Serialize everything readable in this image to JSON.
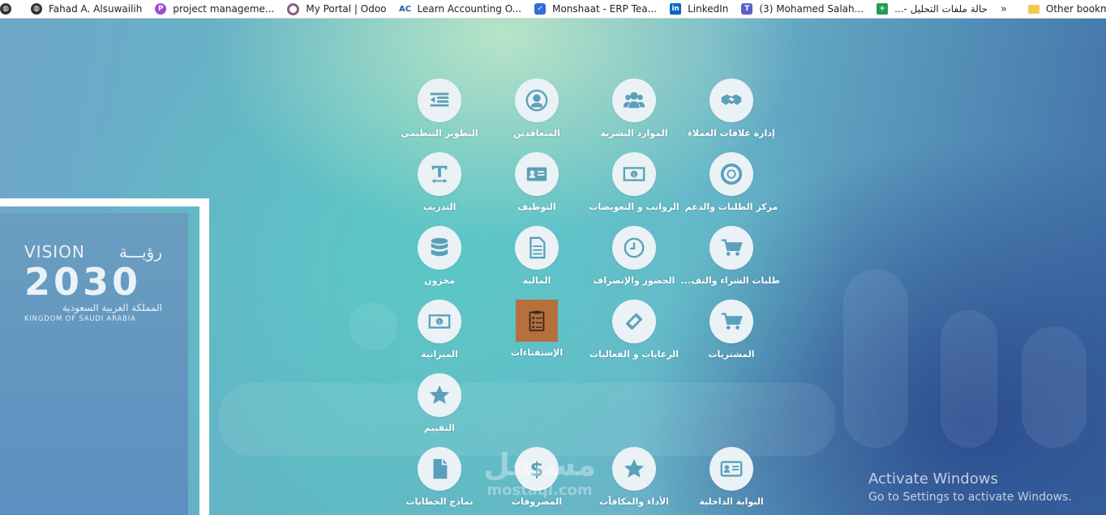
{
  "bookmarks": {
    "items": [
      {
        "label": "",
        "icon": "globe-icon"
      },
      {
        "label": "Fahad A. Alsuwailih",
        "icon": "globe-icon"
      },
      {
        "label": "project manageme...",
        "icon": "podcast-icon"
      },
      {
        "label": "My Portal | Odoo",
        "icon": "odoo-icon"
      },
      {
        "label": "Learn Accounting O...",
        "icon": "ac-icon"
      },
      {
        "label": "Monshaat - ERP Tea...",
        "icon": "teams-icon"
      },
      {
        "label": "LinkedIn",
        "icon": "linkedin-icon"
      },
      {
        "label": "(3) Mohamed Salah...",
        "icon": "teams-icon"
      },
      {
        "label": "حالة ملفات التحليل -...",
        "icon": "sheets-icon"
      }
    ],
    "overflow": "»",
    "other": "Other bookmarks"
  },
  "vision": {
    "vision_en": "VISION",
    "vision_ar": "رؤيـــة",
    "year": "2030",
    "kingdom_ar": "المملكة العربية السعودية",
    "kingdom_en": "KINGDOM OF SAUDI ARABIA"
  },
  "apps": [
    {
      "label": "إدارة علاقات العملاء",
      "icon": "handshake-icon"
    },
    {
      "label": "الموارد البشرية",
      "icon": "users-icon"
    },
    {
      "label": "المتعاقدين",
      "icon": "user-icon"
    },
    {
      "label": "التطوير التنظيمي",
      "icon": "outdent-icon"
    },
    {
      "label": "مركز الطلبات والدعم",
      "icon": "lifebuoy-icon"
    },
    {
      "label": "الرواتب و التعويضات",
      "icon": "money-icon"
    },
    {
      "label": "التوظيف",
      "icon": "id-card-icon"
    },
    {
      "label": "التدريب",
      "icon": "text-width-icon"
    },
    {
      "label": "طلبات الشراء والتف...",
      "icon": "cart-icon"
    },
    {
      "label": "الحضور والإنصراف",
      "icon": "clock-icon"
    },
    {
      "label": "المالية",
      "icon": "document-icon"
    },
    {
      "label": "مخزون",
      "icon": "database-icon"
    },
    {
      "label": "المشتريات",
      "icon": "cart-icon"
    },
    {
      "label": "الرعايات و الفعاليات",
      "icon": "ticket-icon"
    },
    {
      "label": "الإستفتاءات",
      "icon": "survey-icon"
    },
    {
      "label": "الميزانية",
      "icon": "money-icon"
    },
    {
      "label": "التقييم",
      "icon": "star-icon"
    },
    {
      "label": "البوابة الداخلية",
      "icon": "id-card-icon"
    },
    {
      "label": "الأداء والمكافآت",
      "icon": "star-icon"
    },
    {
      "label": "المصروفات",
      "icon": "dollar-icon"
    },
    {
      "label": "نماذج الخطابات",
      "icon": "file-icon"
    }
  ],
  "watermark": {
    "ar": "مستقل",
    "en": "mostaql.com"
  },
  "activate": {
    "title": "Activate Windows",
    "subtitle": "Go to Settings to activate Windows."
  }
}
